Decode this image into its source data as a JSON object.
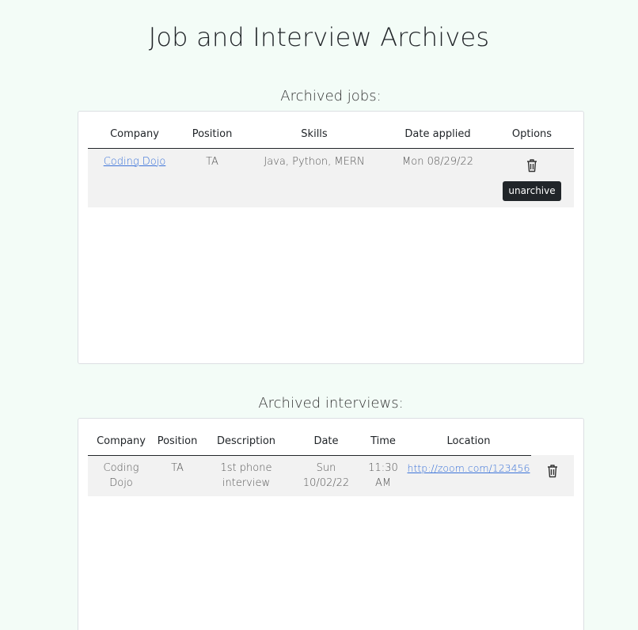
{
  "page": {
    "title": "Job and Interview Archives"
  },
  "jobs": {
    "heading": "Archived jobs:",
    "columns": [
      "Company",
      "Position",
      "Skills",
      "Date applied",
      "Options"
    ],
    "rows": [
      {
        "company": "Coding Dojo",
        "position": "TA",
        "skills": "Java, Python, MERN",
        "date_applied": "Mon 08/29/22",
        "unarchive_label": "unarchive",
        "delete_icon": "trash-icon"
      }
    ]
  },
  "interviews": {
    "heading": "Archived interviews:",
    "columns": [
      "Company",
      "Position",
      "Description",
      "Date",
      "Time",
      "Location"
    ],
    "rows": [
      {
        "company_line1": "Coding",
        "company_line2": "Dojo",
        "position": "TA",
        "description_line1": "1st phone",
        "description_line2": "interview",
        "date_line1": "Sun",
        "date_line2": "10/02/22",
        "time_line1": "11:30",
        "time_line2": "AM",
        "location": "http://zoom.com/123456",
        "delete_icon": "trash-icon"
      }
    ]
  },
  "colors": {
    "background": "#f3fcf7",
    "link": "#3b73d9",
    "button": "#212529"
  }
}
